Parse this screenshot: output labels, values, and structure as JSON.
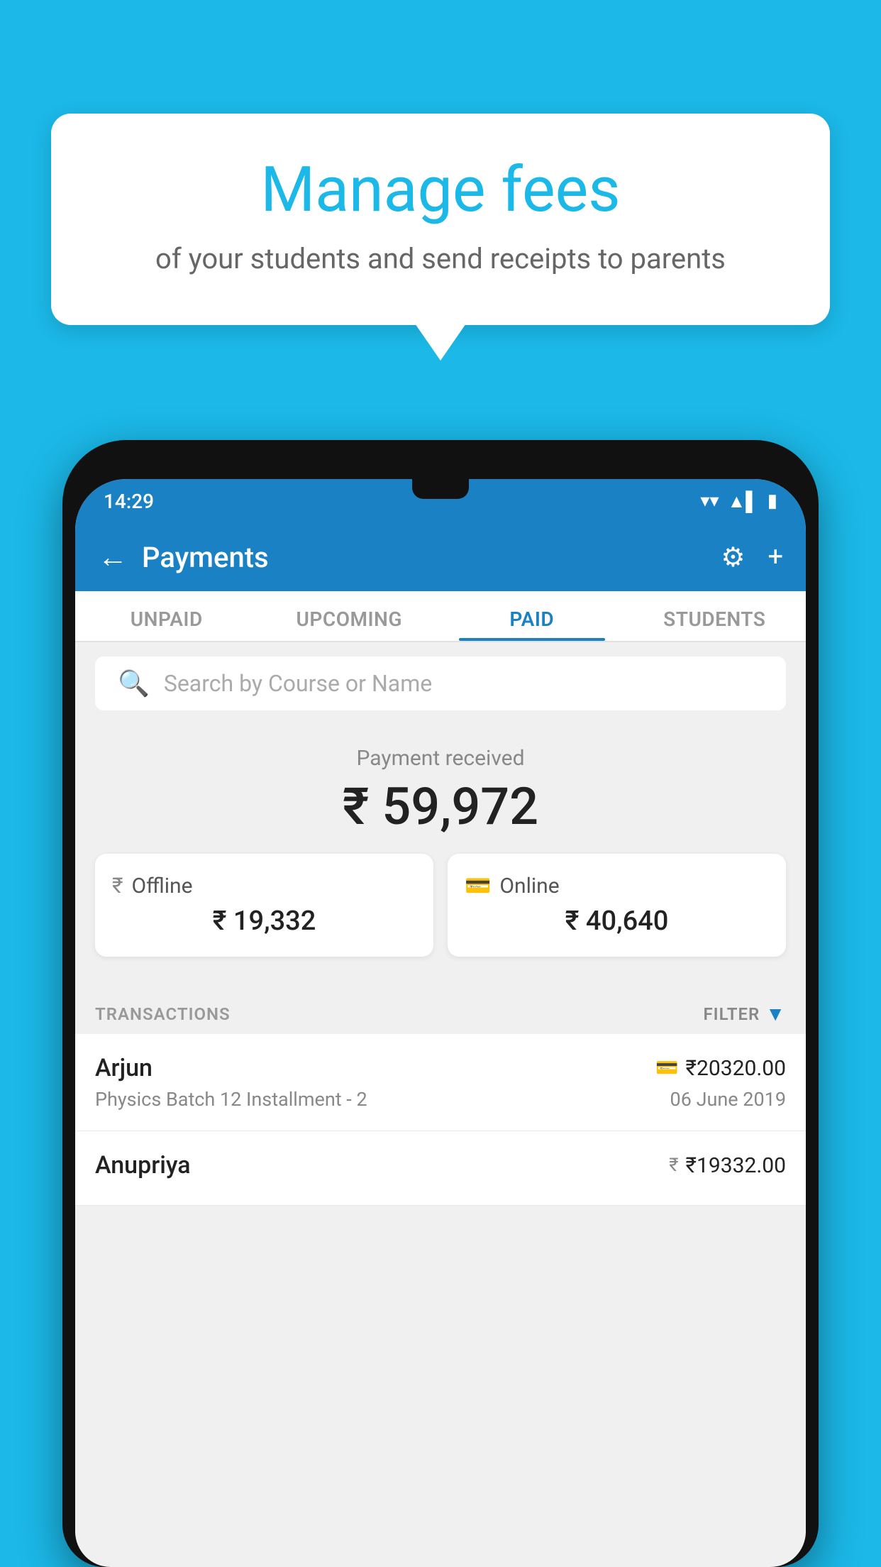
{
  "bubble": {
    "title": "Manage fees",
    "subtitle": "of your students and send receipts to parents"
  },
  "status_bar": {
    "time": "14:29",
    "wifi": "▼",
    "signal": "▲",
    "battery": "▌"
  },
  "header": {
    "title": "Payments",
    "back_label": "←",
    "plus_label": "+"
  },
  "tabs": [
    {
      "label": "UNPAID",
      "active": false
    },
    {
      "label": "UPCOMING",
      "active": false
    },
    {
      "label": "PAID",
      "active": true
    },
    {
      "label": "STUDENTS",
      "active": false
    }
  ],
  "search": {
    "placeholder": "Search by Course or Name"
  },
  "payment_summary": {
    "label": "Payment received",
    "amount": "₹ 59,972",
    "offline": {
      "type": "Offline",
      "amount": "₹ 19,332"
    },
    "online": {
      "type": "Online",
      "amount": "₹ 40,640"
    }
  },
  "transactions": {
    "label": "TRANSACTIONS",
    "filter_label": "FILTER",
    "items": [
      {
        "name": "Arjun",
        "amount": "₹20320.00",
        "course": "Physics Batch 12 Installment - 2",
        "date": "06 June 2019",
        "mode": "card"
      },
      {
        "name": "Anupriya",
        "amount": "₹19332.00",
        "course": "",
        "date": "",
        "mode": "cash"
      }
    ]
  },
  "colors": {
    "primary": "#1a82c4",
    "background": "#1bb8e8",
    "white": "#ffffff",
    "light_gray": "#f0f0f0"
  }
}
